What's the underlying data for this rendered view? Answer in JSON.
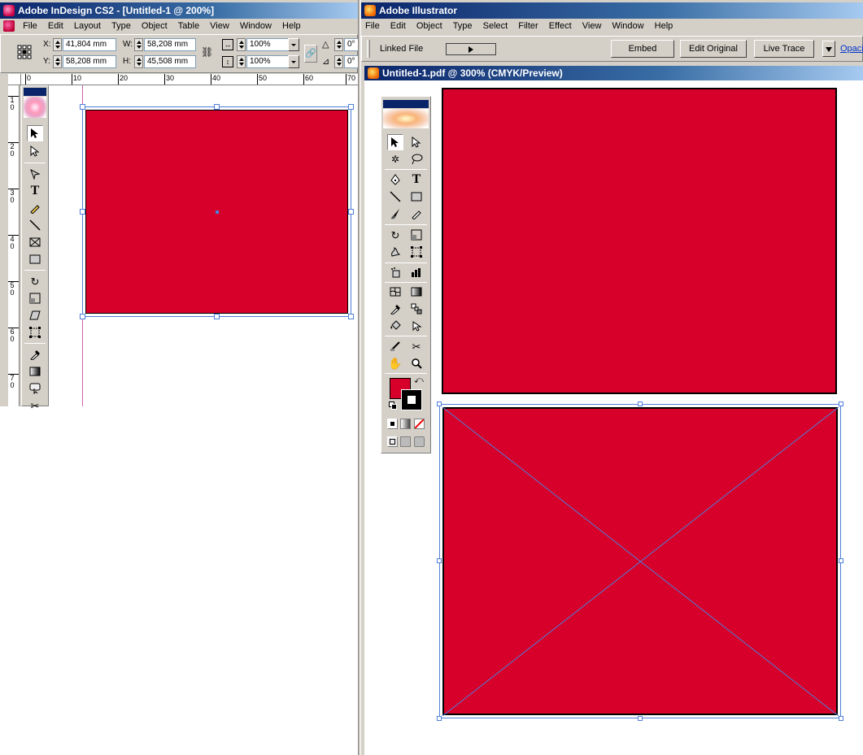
{
  "indesign": {
    "title": "Adobe InDesign CS2 - [Untitled-1 @ 200%]",
    "menu": [
      "File",
      "Edit",
      "Layout",
      "Type",
      "Object",
      "Table",
      "View",
      "Window",
      "Help"
    ],
    "control": {
      "x_label": "X:",
      "x_value": "41,804 mm",
      "y_label": "Y:",
      "y_value": "58,208 mm",
      "w_label": "W:",
      "w_value": "58,208 mm",
      "h_label": "H:",
      "h_value": "45,508 mm",
      "scale_x": "100%",
      "scale_y": "100%",
      "angle1": "0°",
      "angle2": "0°"
    },
    "hruler_labels": [
      "0",
      "10",
      "20",
      "30",
      "40",
      "50",
      "60",
      "70"
    ],
    "vruler_labels": [
      "1\n0",
      "2\n0",
      "3\n0",
      "4\n0",
      "5\n0",
      "6\n0",
      "7\n0"
    ]
  },
  "illustrator": {
    "title": "Adobe Illustrator",
    "menu": [
      "File",
      "Edit",
      "Object",
      "Type",
      "Select",
      "Filter",
      "Effect",
      "View",
      "Window",
      "Help"
    ],
    "control": {
      "linked_file_label": "Linked File",
      "embed_label": "Embed",
      "edit_original_label": "Edit Original",
      "live_trace_label": "Live Trace",
      "opacity_label": "Opacit"
    },
    "doc_title": "Untitled-1.pdf @ 300% (CMYK/Preview)"
  },
  "colors": {
    "fill_red": "#d6002a",
    "selection_blue": "#4f7fd8"
  }
}
